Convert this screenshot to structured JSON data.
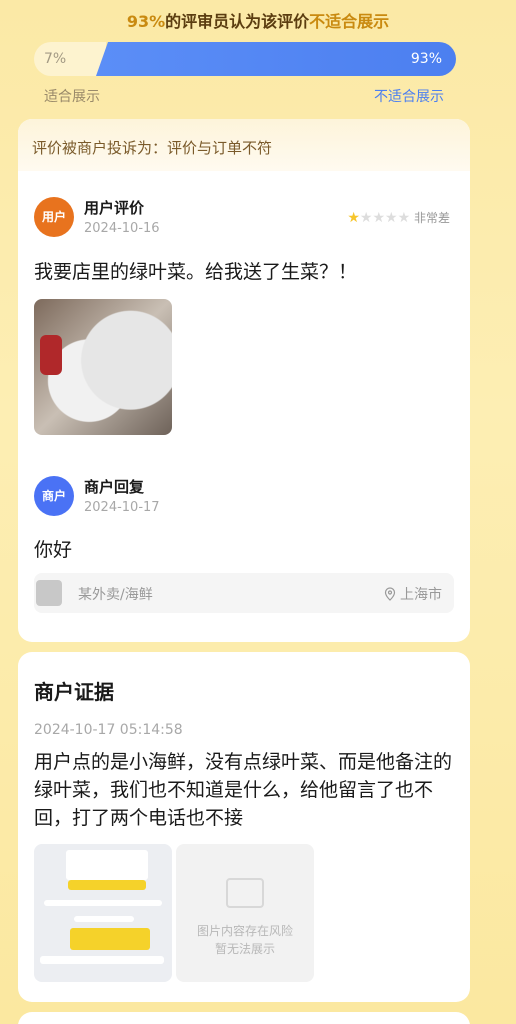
{
  "header": {
    "percent": "93%",
    "middle": "的评审员认为该评价",
    "verdict": "不适合展示"
  },
  "vote": {
    "left_pct": "7%",
    "right_pct": "93%",
    "left_label": "适合展示",
    "right_label": "不适合展示",
    "unsuitable_fraction": 0.93
  },
  "complaint": {
    "text": "评价被商户投诉为：评价与订单不符"
  },
  "review": {
    "avatar": "用户",
    "name": "用户评价",
    "date": "2024-10-16",
    "stars_total": 5,
    "stars_on": 1,
    "rating_text": "非常差",
    "text": "我要店里的绿叶菜。给我送了生菜？！"
  },
  "reply": {
    "avatar": "商户",
    "name": "商户回复",
    "date": "2024-10-17",
    "text": "你好"
  },
  "store": {
    "name": "某外卖/海鲜",
    "city": "上海市",
    "pin_icon": "location-pin-icon"
  },
  "evidence": {
    "title": "商户证据",
    "time": "2024-10-17 05:14:58",
    "text": "用户点的是小海鲜，没有点绿叶菜、而是他备注的绿叶菜，我们也不知道是什么，给他留言了也不回，打了两个电话也不接",
    "blocked_line1": "图片内容存在风险",
    "blocked_line2": "暂无法展示"
  },
  "colors": {
    "accent_blue": "#4c7ff0",
    "accent_gold": "#c98a10",
    "user_avatar": "#e8731e",
    "merchant_avatar": "#4a72f5",
    "star": "#f6c52b"
  }
}
